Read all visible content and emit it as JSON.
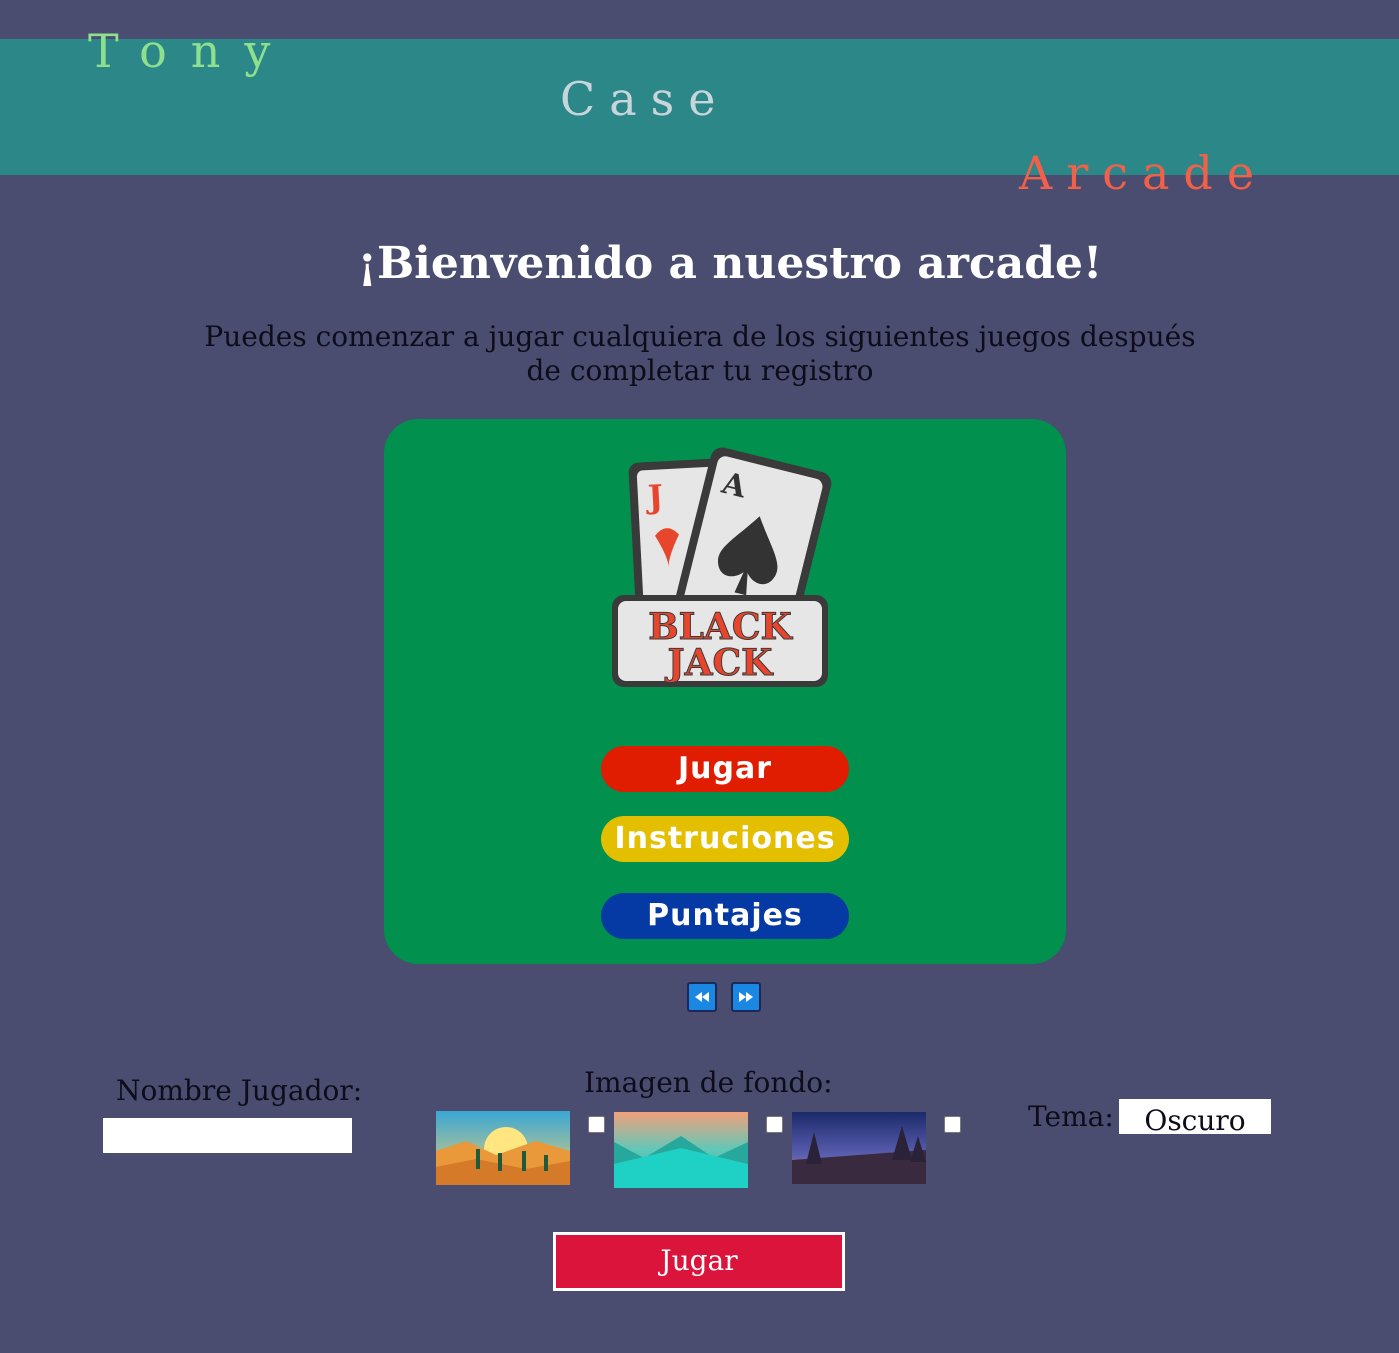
{
  "brand": {
    "word_1": "Tony",
    "word_2": "Case",
    "word_3": "Arcade"
  },
  "welcome": {
    "title": "¡Bienvenido a nuestro arcade!",
    "intro": "Puedes comenzar a jugar cualquiera de los siguientes juegos después de completar tu registro"
  },
  "game_card": {
    "logo_line_1": "BLACK",
    "logo_line_2": "JACK",
    "card_left_letter": "J",
    "card_right_letter": "A",
    "menu": {
      "play": "Jugar",
      "instructions": "Instruciones",
      "scores": "Puntajes"
    }
  },
  "carousel": {
    "prev_icon": "rewind-icon",
    "next_icon": "fast-forward-icon"
  },
  "form": {
    "player_label": "Nombre Jugador:",
    "player_value": "",
    "background_label": "Imagen de fondo:",
    "backgrounds": [
      {
        "name": "desert-sunset",
        "checked": false
      },
      {
        "name": "teal-mountains",
        "checked": false
      },
      {
        "name": "night-forest",
        "checked": false
      }
    ],
    "theme_label": "Tema:",
    "theme_value": "Oscuro",
    "submit_label": "Jugar"
  },
  "colors": {
    "page_background": "#4a4c70",
    "header_band": "#2c8888",
    "brand_word_1": "#8ee08e",
    "brand_word_2": "#c8d6dc",
    "brand_word_3": "#f2604a",
    "card_background": "#01904d",
    "play_pill": "#e01d00",
    "instructions_pill": "#e3bf00",
    "scores_pill": "#0539a3",
    "submit_button": "#db143c"
  }
}
